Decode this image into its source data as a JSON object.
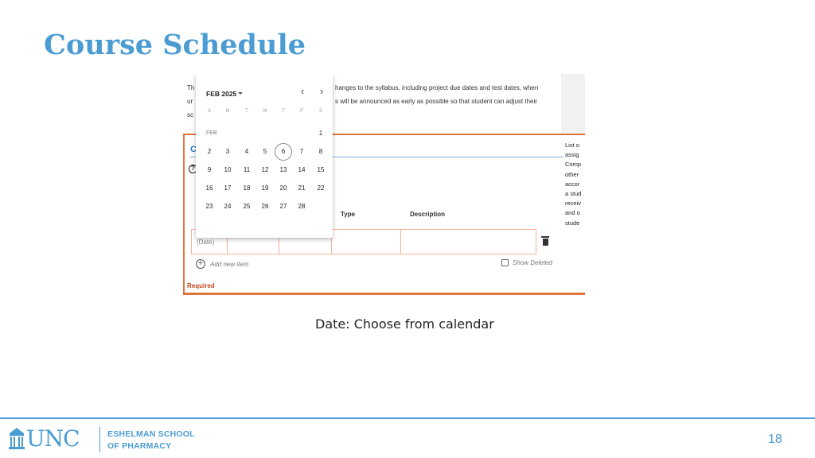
{
  "slide": {
    "title": "Course Schedule",
    "caption": "Date: Choose from calendar",
    "page_number": "18"
  },
  "footer": {
    "logo_text": "UNC",
    "school_line1": "ESHELMAN SCHOOL",
    "school_line2": "OF PHARMACY"
  },
  "form": {
    "intro_lines": [
      "hanges to the syllabus, including project due dates and test dates, when",
      "s will be announced as early as possible so that student can adjust their"
    ],
    "intro_left_fragments": [
      "Th",
      "ur",
      "sc"
    ],
    "section_initial": "C",
    "columns": [
      "Type",
      "Description"
    ],
    "date_placeholder": "(Date)",
    "add_item_label": "Add new item",
    "show_deleted_label": "Show Deleted",
    "required_label": "Required",
    "help_text_lines": [
      "List o",
      "assig",
      "Comp",
      "other",
      "accor",
      "a stud",
      "receiv",
      "and o",
      "stude"
    ]
  },
  "calendar": {
    "month_year": "FEB 2025",
    "month_label": "FEB",
    "weekdays": [
      "S",
      "M",
      "T",
      "W",
      "T",
      "F",
      "S"
    ],
    "selected_day": "6",
    "weeks": [
      [
        "",
        "",
        "",
        "",
        "",
        "",
        "1"
      ],
      [
        "2",
        "3",
        "4",
        "5",
        "6",
        "7",
        "8"
      ],
      [
        "9",
        "10",
        "11",
        "12",
        "13",
        "14",
        "15"
      ],
      [
        "16",
        "17",
        "18",
        "19",
        "20",
        "21",
        "22"
      ],
      [
        "23",
        "24",
        "25",
        "26",
        "27",
        "28",
        ""
      ]
    ]
  },
  "colors": {
    "brand_blue": "#4b9cd3",
    "required_orange": "#e0743a"
  }
}
